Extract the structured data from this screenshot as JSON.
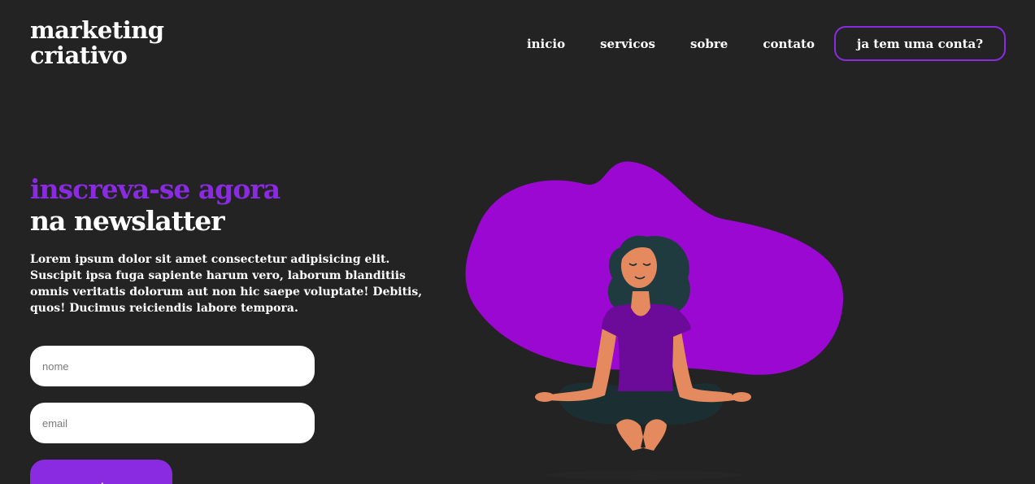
{
  "logo": {
    "line1": "marketing",
    "line2": "criativo"
  },
  "nav": {
    "items": [
      {
        "label": "inicio"
      },
      {
        "label": "servicos"
      },
      {
        "label": "sobre"
      },
      {
        "label": "contato"
      }
    ],
    "account_button": "ja tem uma conta?"
  },
  "hero": {
    "headline_accent": "inscreva-se agora",
    "headline_main": "na newslatter",
    "description": "Lorem ipsum dolor sit amet consectetur adipisicing elit. Suscipit ipsa fuga sapiente harum vero, laborum blanditiis omnis veritatis dolorum aut non hic saepe voluptate! Debitis, quos! Ducimus reiciendis labore tempora."
  },
  "form": {
    "name_placeholder": "nome",
    "email_placeholder": "email",
    "submit_label": "enviar>"
  },
  "colors": {
    "background": "#232323",
    "accent": "#8a2be2",
    "blob": "#9b08d1"
  },
  "illustration": {
    "icon": "meditating-woman-illustration"
  }
}
